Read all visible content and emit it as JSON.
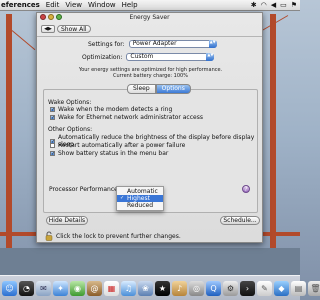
{
  "menubar": {
    "app_name": "eferences",
    "items": [
      "Edit",
      "View",
      "Window",
      "Help"
    ],
    "status_icons": [
      "bluetooth-icon",
      "wifi-icon",
      "volume-icon",
      "battery-icon",
      "flag-icon"
    ]
  },
  "window": {
    "title": "Energy Saver",
    "toolbar": {
      "show_all": "Show All"
    },
    "settings_for": {
      "label": "Settings for:",
      "value": "Power Adapter"
    },
    "optimization": {
      "label": "Optimization:",
      "value": "Custom"
    },
    "info_line1": "Your energy settings are optimized for high performance.",
    "info_line2": "Current battery charge: 100%",
    "tabs": [
      {
        "label": "Sleep"
      },
      {
        "label": "Options"
      }
    ],
    "wake_options": {
      "title": "Wake Options:",
      "items": [
        {
          "label": "Wake when the modem detects a ring",
          "checked": true
        },
        {
          "label": "Wake for Ethernet network administrator access",
          "checked": true
        }
      ]
    },
    "other_options": {
      "title": "Other Options:",
      "items": [
        {
          "label": "Automatically reduce the brightness of the display before display sleep",
          "checked": true
        },
        {
          "label": "Restart automatically after a power failure",
          "checked": false
        },
        {
          "label": "Show battery status in the menu bar",
          "checked": true
        }
      ]
    },
    "processor_performance": {
      "label": "Processor Performance"
    },
    "dropdown_menu": {
      "options": [
        "Automatic",
        "Highest",
        "Reduced"
      ],
      "selected": "Highest"
    },
    "help": "?",
    "hide_details": "Hide Details",
    "schedule": "Schedule...",
    "lock_text": "Click the lock to prevent further changes."
  },
  "dock": {
    "icons": [
      "finder-icon",
      "dashboard-icon",
      "mail-icon",
      "safari-icon",
      "ichat-icon",
      "address-book-icon",
      "ical-icon",
      "itunes-icon",
      "iphoto-icon",
      "imovie-icon",
      "garageband-icon",
      "idvd-icon",
      "quicktime-icon",
      "system-preferences-icon",
      "terminal-icon",
      "textedit-icon",
      "app-icon",
      "app-icon-2",
      "trash-icon"
    ]
  }
}
